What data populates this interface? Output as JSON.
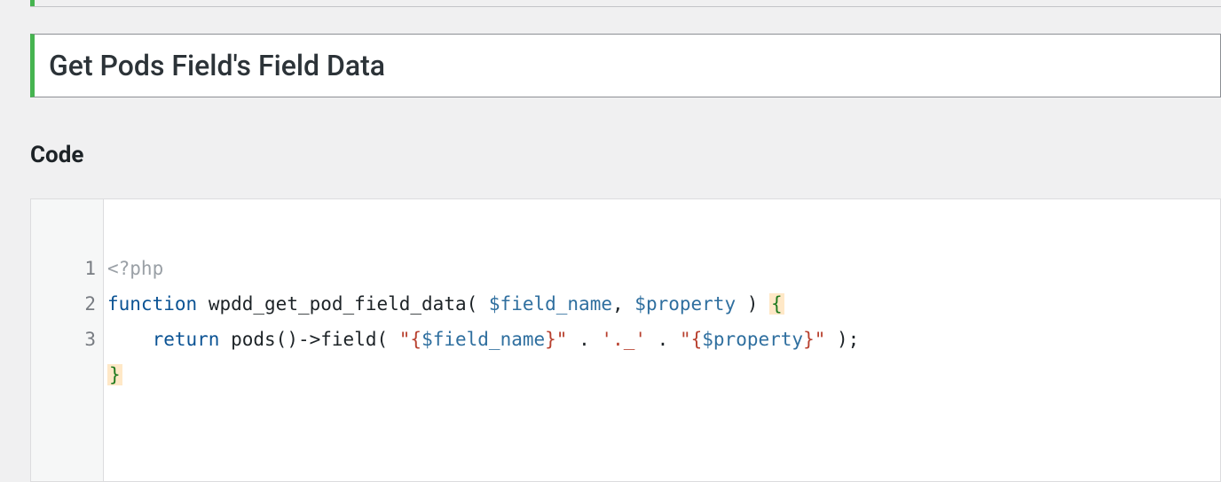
{
  "title": "Get Pods Field's Field Data",
  "section_label": "Code",
  "gutter": [
    "1",
    "2",
    "3"
  ],
  "code": {
    "phptag": "<?php",
    "line1": {
      "kw": "function",
      "name": "wpdd_get_pod_field_data",
      "p1": "$field_name",
      "comma": ",",
      "p2": "$property",
      "open": "{"
    },
    "line2": {
      "indent": "    ",
      "kw": "return",
      "call1": "pods",
      "arrow": "->",
      "call2": "field",
      "str1": "\"{",
      "var1": "$field_name",
      "str1e": "}\"",
      "dot1": ".",
      "str2": "'._'",
      "dot2": ".",
      "str3": "\"{",
      "var2": "$property",
      "str3e": "}\"",
      "end": ");"
    },
    "line3": {
      "close": "}"
    }
  }
}
